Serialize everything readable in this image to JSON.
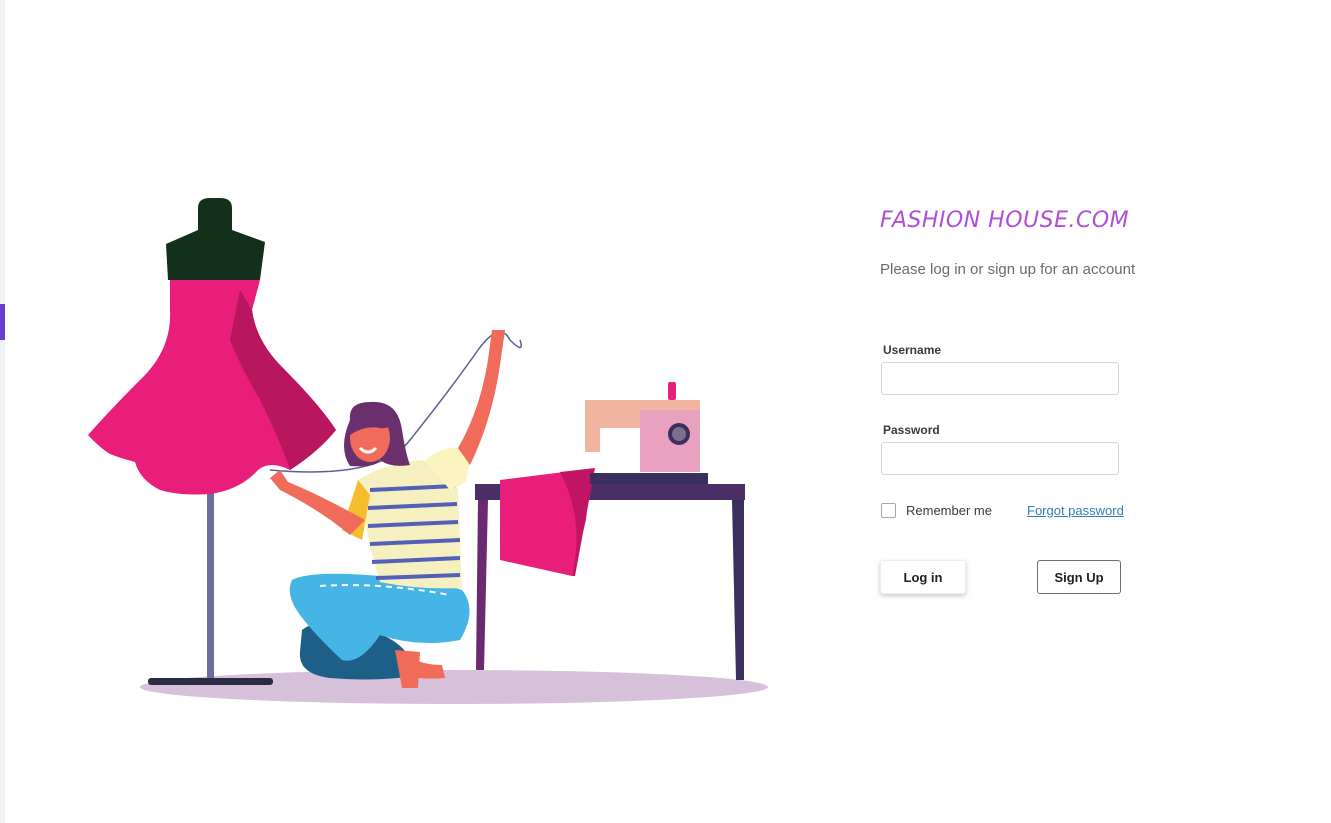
{
  "brand": {
    "title": "FASHION HOUSE.COM",
    "color": "#b24ed6"
  },
  "subtitle": "Please log in or sign up for an account",
  "form": {
    "username_label": "Username",
    "username_value": "",
    "password_label": "Password",
    "password_value": "",
    "remember_label": "Remember me",
    "remember_checked": false,
    "forgot_label": "Forgot password",
    "login_label": "Log in",
    "signup_label": "Sign Up"
  },
  "colors": {
    "accent": "#6a3fd0",
    "link": "#2f7fb7",
    "dress": "#e91e7a",
    "table": "#3b2f5e"
  },
  "illustration": {
    "icon": "seamstress-illustration"
  }
}
